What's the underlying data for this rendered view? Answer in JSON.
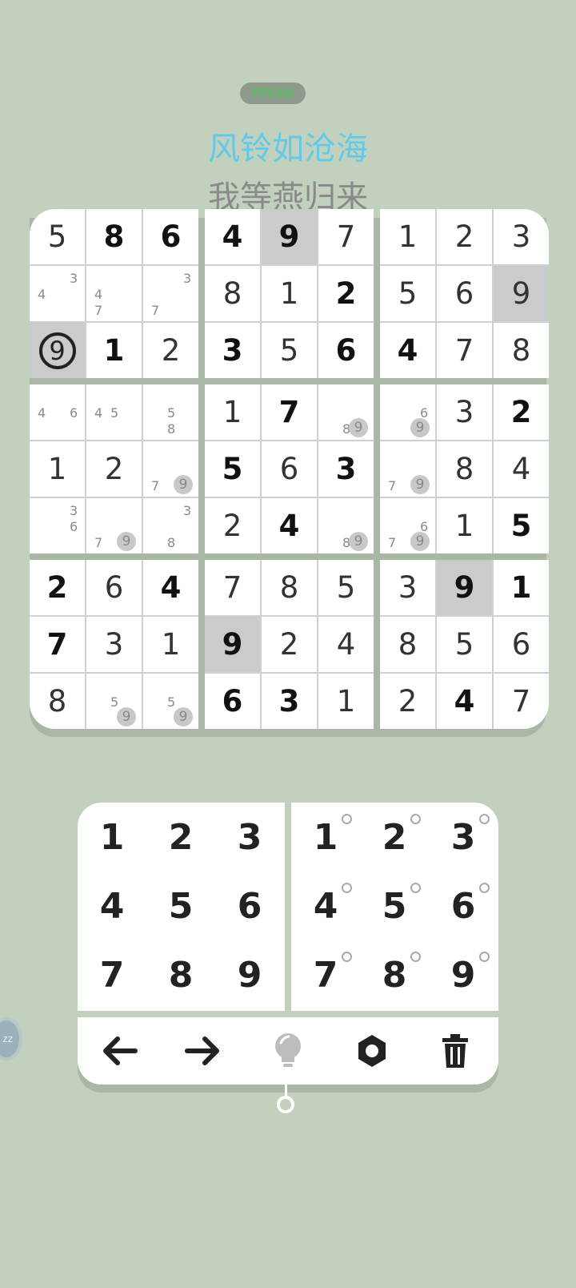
{
  "fps_label": "FPS60",
  "title": "风铃如沧海",
  "subtitle": "我等燕归来",
  "side_button_label": "zz",
  "colors": {
    "background": "#c1d1bd",
    "title": "#63c9e8",
    "subtitle": "#8a8a8a",
    "fps_text": "#3fcf4a",
    "highlight": "#cbcbcb"
  },
  "board": {
    "rows": [
      [
        {
          "v": "5",
          "t": "entered"
        },
        {
          "v": "8",
          "t": "given"
        },
        {
          "v": "6",
          "t": "given"
        },
        {
          "v": "4",
          "t": "given"
        },
        {
          "v": "9",
          "t": "given",
          "hl": true
        },
        {
          "v": "7",
          "t": "entered"
        },
        {
          "v": "1",
          "t": "entered"
        },
        {
          "v": "2",
          "t": "entered"
        },
        {
          "v": "3",
          "t": "entered"
        }
      ],
      [
        {
          "notes": [
            "3",
            "4"
          ]
        },
        {
          "notes": [
            "4",
            "7"
          ]
        },
        {
          "notes": [
            "3",
            "7"
          ]
        },
        {
          "v": "8",
          "t": "entered"
        },
        {
          "v": "1",
          "t": "entered"
        },
        {
          "v": "2",
          "t": "given"
        },
        {
          "v": "5",
          "t": "entered"
        },
        {
          "v": "6",
          "t": "entered"
        },
        {
          "v": "9",
          "t": "entered",
          "hl": true
        }
      ],
      [
        {
          "v": "9",
          "t": "selected",
          "hl": true
        },
        {
          "v": "1",
          "t": "given"
        },
        {
          "v": "2",
          "t": "entered"
        },
        {
          "v": "3",
          "t": "given"
        },
        {
          "v": "5",
          "t": "entered"
        },
        {
          "v": "6",
          "t": "given"
        },
        {
          "v": "4",
          "t": "given"
        },
        {
          "v": "7",
          "t": "entered"
        },
        {
          "v": "8",
          "t": "entered"
        }
      ],
      [
        {
          "notes": [
            "4",
            "6"
          ]
        },
        {
          "notes": [
            "4",
            "5"
          ]
        },
        {
          "notes": [
            "5",
            "8"
          ]
        },
        {
          "v": "1",
          "t": "entered"
        },
        {
          "v": "7",
          "t": "given"
        },
        {
          "notes": [
            "8"
          ],
          "dot": "9"
        },
        {
          "notes": [
            "6"
          ],
          "dot": "9"
        },
        {
          "v": "3",
          "t": "entered"
        },
        {
          "v": "2",
          "t": "given"
        }
      ],
      [
        {
          "v": "1",
          "t": "entered"
        },
        {
          "v": "2",
          "t": "entered"
        },
        {
          "notes": [
            "7"
          ],
          "dot": "9"
        },
        {
          "v": "5",
          "t": "given"
        },
        {
          "v": "6",
          "t": "entered"
        },
        {
          "v": "3",
          "t": "given"
        },
        {
          "notes": [
            "7"
          ],
          "dot": "9"
        },
        {
          "v": "8",
          "t": "entered"
        },
        {
          "v": "4",
          "t": "entered"
        }
      ],
      [
        {
          "notes": [
            "3",
            "6"
          ]
        },
        {
          "notes": [
            "7"
          ],
          "dot": "9"
        },
        {
          "notes": [
            "3",
            "8"
          ]
        },
        {
          "v": "2",
          "t": "entered"
        },
        {
          "v": "4",
          "t": "given"
        },
        {
          "notes": [
            "8"
          ],
          "dot": "9"
        },
        {
          "notes": [
            "6",
            "7"
          ],
          "dot": "9"
        },
        {
          "v": "1",
          "t": "entered"
        },
        {
          "v": "5",
          "t": "given"
        }
      ],
      [
        {
          "v": "2",
          "t": "given"
        },
        {
          "v": "6",
          "t": "entered"
        },
        {
          "v": "4",
          "t": "given"
        },
        {
          "v": "7",
          "t": "entered"
        },
        {
          "v": "8",
          "t": "entered"
        },
        {
          "v": "5",
          "t": "entered"
        },
        {
          "v": "3",
          "t": "entered"
        },
        {
          "v": "9",
          "t": "given",
          "hl": true
        },
        {
          "v": "1",
          "t": "given"
        }
      ],
      [
        {
          "v": "7",
          "t": "given"
        },
        {
          "v": "3",
          "t": "entered"
        },
        {
          "v": "1",
          "t": "entered"
        },
        {
          "v": "9",
          "t": "given",
          "hl": true
        },
        {
          "v": "2",
          "t": "entered"
        },
        {
          "v": "4",
          "t": "entered"
        },
        {
          "v": "8",
          "t": "entered"
        },
        {
          "v": "5",
          "t": "entered"
        },
        {
          "v": "6",
          "t": "entered"
        }
      ],
      [
        {
          "v": "8",
          "t": "entered"
        },
        {
          "notes": [
            "5"
          ],
          "dot": "9"
        },
        {
          "notes": [
            "5"
          ],
          "dot": "9"
        },
        {
          "v": "6",
          "t": "given"
        },
        {
          "v": "3",
          "t": "given"
        },
        {
          "v": "1",
          "t": "entered"
        },
        {
          "v": "2",
          "t": "entered"
        },
        {
          "v": "4",
          "t": "given"
        },
        {
          "v": "7",
          "t": "entered"
        }
      ]
    ]
  },
  "keypad": {
    "digits": [
      "1",
      "2",
      "3",
      "4",
      "5",
      "6",
      "7",
      "8",
      "9"
    ],
    "note_digits": [
      "1",
      "2",
      "3",
      "4",
      "5",
      "6",
      "7",
      "8",
      "9"
    ]
  },
  "toolbar": [
    {
      "name": "back-arrow-icon",
      "color": "#222"
    },
    {
      "name": "forward-arrow-icon",
      "color": "#222"
    },
    {
      "name": "hint-bulb-icon",
      "color": "#bdbdbd"
    },
    {
      "name": "settings-gear-icon",
      "color": "#222"
    },
    {
      "name": "trash-icon",
      "color": "#222"
    }
  ]
}
